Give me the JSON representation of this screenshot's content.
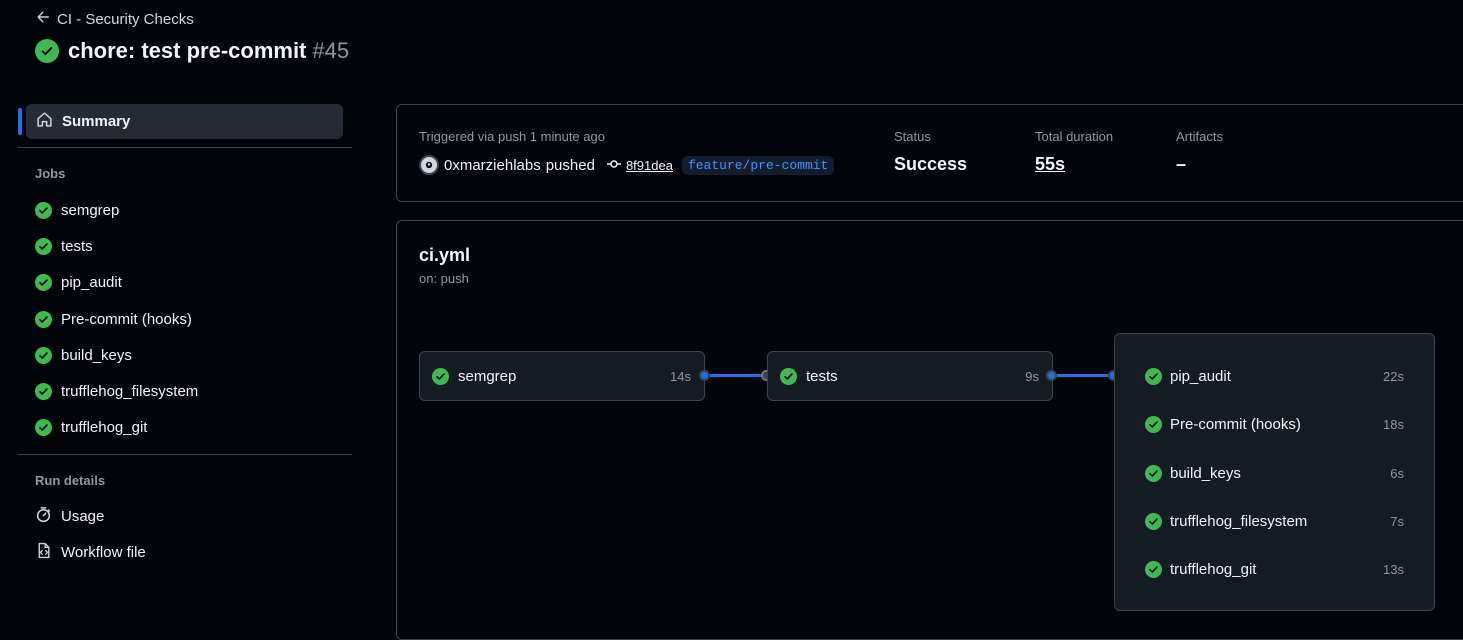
{
  "header": {
    "back_label": "CI - Security Checks",
    "run_title": "chore: test pre-commit",
    "run_number": "#45"
  },
  "sidebar": {
    "summary_label": "Summary",
    "jobs_heading": "Jobs",
    "jobs": [
      {
        "label": "semgrep",
        "status": "success"
      },
      {
        "label": "tests",
        "status": "success"
      },
      {
        "label": "pip_audit",
        "status": "success"
      },
      {
        "label": "Pre-commit (hooks)",
        "status": "success"
      },
      {
        "label": "build_keys",
        "status": "success"
      },
      {
        "label": "trufflehog_filesystem",
        "status": "success"
      },
      {
        "label": "trufflehog_git",
        "status": "success"
      }
    ],
    "run_details_heading": "Run details",
    "usage_label": "Usage",
    "workflow_file_label": "Workflow file"
  },
  "run_info": {
    "trigger_text": "Triggered via push 1 minute ago",
    "actor": "0xmarziehlabs",
    "action": "pushed",
    "commit_sha": "8f91dea",
    "branch": "feature/pre-commit",
    "status_label": "Status",
    "status_value": "Success",
    "duration_label": "Total duration",
    "duration_value": "55s",
    "artifacts_label": "Artifacts",
    "artifacts_value": "–"
  },
  "workflow": {
    "file": "ci.yml",
    "trigger": "on: push",
    "stage1": {
      "name": "semgrep",
      "time": "14s"
    },
    "stage2": {
      "name": "tests",
      "time": "9s"
    },
    "stage3": [
      {
        "name": "pip_audit",
        "time": "22s"
      },
      {
        "name": "Pre-commit (hooks)",
        "time": "18s"
      },
      {
        "name": "build_keys",
        "time": "6s"
      },
      {
        "name": "trufflehog_filesystem",
        "time": "7s"
      },
      {
        "name": "trufflehog_git",
        "time": "13s"
      }
    ]
  },
  "colors": {
    "success": "#3fb950",
    "accent": "#1f6feb",
    "background": "#010409"
  }
}
